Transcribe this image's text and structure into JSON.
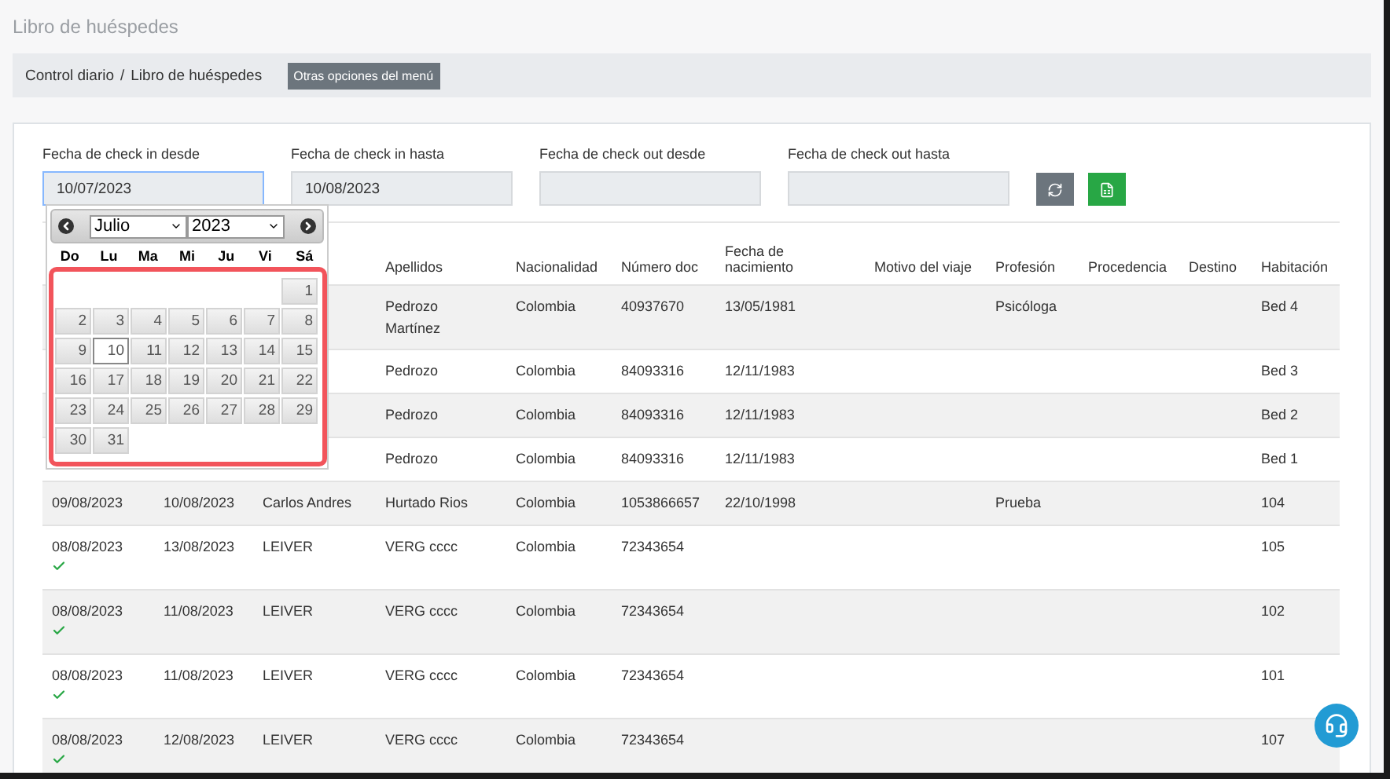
{
  "page_title": "Libro de huéspedes",
  "breadcrumb": {
    "items": [
      "Control diario",
      "Libro de huéspedes"
    ],
    "separator": "/",
    "menu_button": "Otras opciones del menú"
  },
  "filters": [
    {
      "label": "Fecha de check in desde",
      "value": "10/07/2023",
      "focused": true
    },
    {
      "label": "Fecha de check in hasta",
      "value": "10/08/2023",
      "focused": false
    },
    {
      "label": "Fecha de check out desde",
      "focused": false
    },
    {
      "label": "Fecha de check out hasta",
      "focused": false
    }
  ],
  "datepicker": {
    "month": "Julio",
    "year": "2023",
    "weekdays": [
      "Do",
      "Lu",
      "Ma",
      "Mi",
      "Ju",
      "Vi",
      "Sá"
    ],
    "weeks": [
      [
        {
          "day": "1",
          "selected": false
        }
      ],
      [
        {
          "day": "2",
          "selected": false
        },
        {
          "day": "3",
          "selected": false
        },
        {
          "day": "4",
          "selected": false
        },
        {
          "day": "5",
          "selected": false
        },
        {
          "day": "6",
          "selected": false
        },
        {
          "day": "7",
          "selected": false
        },
        {
          "day": "8",
          "selected": false
        }
      ],
      [
        {
          "day": "9",
          "selected": false
        },
        {
          "day": "10",
          "selected": true
        },
        {
          "day": "11",
          "selected": false
        },
        {
          "day": "12",
          "selected": false
        },
        {
          "day": "13",
          "selected": false
        },
        {
          "day": "14",
          "selected": false
        },
        {
          "day": "15",
          "selected": false
        }
      ],
      [
        {
          "day": "16",
          "selected": false
        },
        {
          "day": "17",
          "selected": false
        },
        {
          "day": "18",
          "selected": false
        },
        {
          "day": "19",
          "selected": false
        },
        {
          "day": "20",
          "selected": false
        },
        {
          "day": "21",
          "selected": false
        },
        {
          "day": "22",
          "selected": false
        }
      ],
      [
        {
          "day": "23",
          "selected": false
        },
        {
          "day": "24",
          "selected": false
        },
        {
          "day": "25",
          "selected": false
        },
        {
          "day": "26",
          "selected": false
        },
        {
          "day": "27",
          "selected": false
        },
        {
          "day": "28",
          "selected": false
        },
        {
          "day": "29",
          "selected": false
        }
      ],
      [
        {
          "day": "30",
          "selected": false
        },
        {
          "day": "31",
          "selected": false
        }
      ]
    ]
  },
  "table": {
    "columns": [
      {},
      {},
      {},
      {
        "label": "Apellidos"
      },
      {
        "label": "Nacionalidad"
      },
      {
        "label": "Número doc"
      },
      {
        "label": "Fecha de nacimiento"
      },
      {
        "label": "Motivo del viaje"
      },
      {
        "label": "Profesión"
      },
      {
        "label": "Procedencia"
      },
      {
        "label": "Destino"
      },
      {
        "label": "Habitación"
      }
    ],
    "rows": [
      {
        "verified": false,
        "cells": [
          {},
          {},
          {},
          {
            "text": "Pedrozo Martínez"
          },
          {
            "text": "Colombia"
          },
          {
            "text": "40937670"
          },
          {
            "text": "13/05/1981"
          },
          {},
          {
            "text": "Psicóloga"
          },
          {},
          {},
          {
            "text": "Bed 4"
          }
        ]
      },
      {
        "verified": false,
        "cells": [
          {},
          {},
          {},
          {
            "text": "Pedrozo"
          },
          {
            "text": "Colombia"
          },
          {
            "text": "84093316"
          },
          {
            "text": "12/11/1983"
          },
          {},
          {},
          {},
          {},
          {
            "text": "Bed 3"
          }
        ]
      },
      {
        "verified": false,
        "cells": [
          {},
          {},
          {},
          {
            "text": "Pedrozo"
          },
          {
            "text": "Colombia"
          },
          {
            "text": "84093316"
          },
          {
            "text": "12/11/1983"
          },
          {},
          {},
          {},
          {},
          {
            "text": "Bed 2"
          }
        ]
      },
      {
        "verified": false,
        "cells": [
          {},
          {},
          {},
          {
            "text": "Pedrozo"
          },
          {
            "text": "Colombia"
          },
          {
            "text": "84093316"
          },
          {
            "text": "12/11/1983"
          },
          {},
          {},
          {},
          {},
          {
            "text": "Bed 1"
          }
        ]
      },
      {
        "verified": false,
        "cells": [
          {
            "text": "09/08/2023"
          },
          {
            "text": "10/08/2023"
          },
          {
            "text": "Carlos Andres"
          },
          {
            "text": "Hurtado Rios"
          },
          {
            "text": "Colombia"
          },
          {
            "text": "1053866657"
          },
          {
            "text": "22/10/1998"
          },
          {},
          {
            "text": "Prueba"
          },
          {},
          {},
          {
            "text": "104"
          }
        ]
      },
      {
        "verified": true,
        "cells": [
          {
            "text": "08/08/2023"
          },
          {
            "text": "13/08/2023"
          },
          {
            "text": "LEIVER"
          },
          {
            "text": "VERG cccc"
          },
          {
            "text": "Colombia"
          },
          {
            "text": "72343654"
          },
          {},
          {},
          {},
          {},
          {},
          {
            "text": "105"
          }
        ]
      },
      {
        "verified": true,
        "cells": [
          {
            "text": "08/08/2023"
          },
          {
            "text": "11/08/2023"
          },
          {
            "text": "LEIVER"
          },
          {
            "text": "VERG cccc"
          },
          {
            "text": "Colombia"
          },
          {
            "text": "72343654"
          },
          {},
          {},
          {},
          {},
          {},
          {
            "text": "102"
          }
        ]
      },
      {
        "verified": true,
        "cells": [
          {
            "text": "08/08/2023"
          },
          {
            "text": "11/08/2023"
          },
          {
            "text": "LEIVER"
          },
          {
            "text": "VERG cccc"
          },
          {
            "text": "Colombia"
          },
          {
            "text": "72343654"
          },
          {},
          {},
          {},
          {},
          {},
          {
            "text": "101"
          }
        ]
      },
      {
        "verified": true,
        "cells": [
          {
            "text": "08/08/2023"
          },
          {
            "text": "12/08/2023"
          },
          {
            "text": "LEIVER"
          },
          {
            "text": "VERG cccc"
          },
          {
            "text": "Colombia"
          },
          {
            "text": "72343654"
          },
          {},
          {},
          {},
          {},
          {},
          {
            "text": "107"
          }
        ]
      }
    ]
  }
}
